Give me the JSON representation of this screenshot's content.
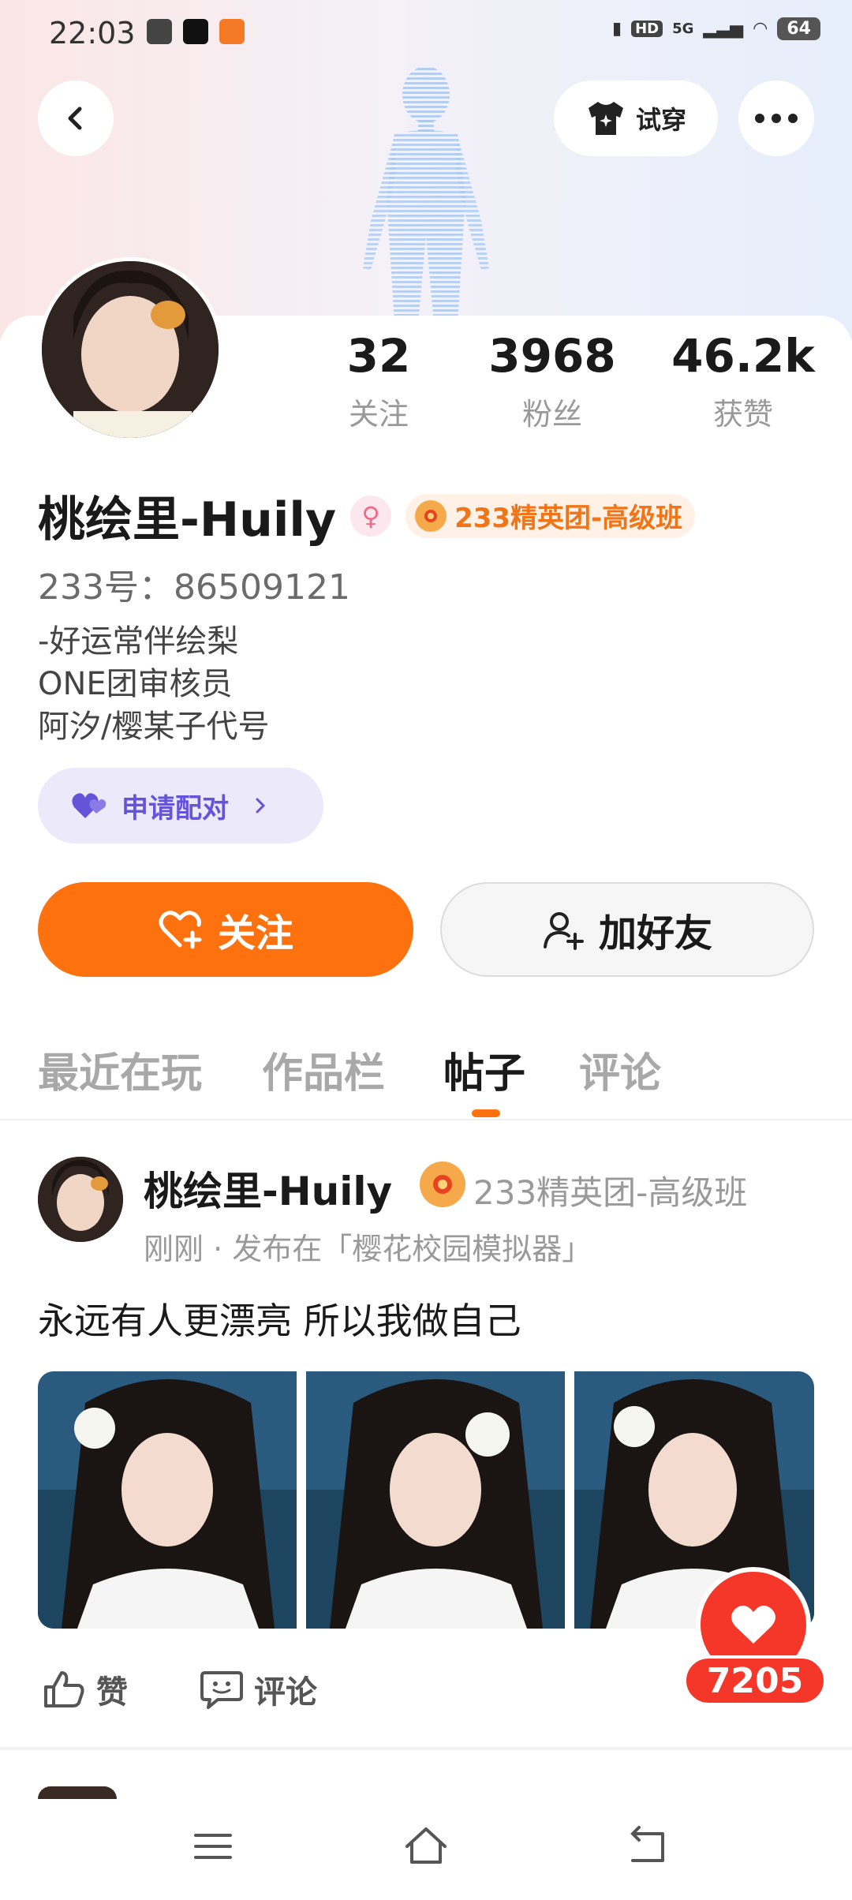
{
  "status_bar": {
    "time": "22:03",
    "network": "5G",
    "hd": "HD",
    "battery": "64"
  },
  "header": {
    "try_on_label": "试穿",
    "icons": [
      "back-icon",
      "tshirt-icon",
      "more-icon"
    ]
  },
  "profile": {
    "stats": [
      {
        "value": "32",
        "label": "关注"
      },
      {
        "value": "3968",
        "label": "粉丝"
      },
      {
        "value": "46.2k",
        "label": "获赞"
      }
    ],
    "name": "桃绘里-Huily",
    "gender_symbol": "♀",
    "elite_badge": "233精英团-高级班",
    "uid": "233号：86509121",
    "bio_lines": [
      "-好运常伴绘梨",
      "ONE团审核员",
      "阿汐/樱某子代号"
    ],
    "pair_label": "申请配对",
    "follow_label": "关注",
    "add_friend_label": "加好友"
  },
  "tabs": [
    {
      "label": "最近在玩",
      "active": false
    },
    {
      "label": "作品栏",
      "active": false
    },
    {
      "label": "帖子",
      "active": true
    },
    {
      "label": "评论",
      "active": false
    }
  ],
  "post": {
    "author": "桃绘里-Huily",
    "badge": "233精英团-高级班",
    "meta": "刚刚 · 发布在「樱花校园模拟器」",
    "text": "永远有人更漂亮 所以我做自己",
    "like_label": "赞",
    "comment_label": "评论",
    "heart_count": "7205"
  },
  "colors": {
    "accent": "#fd720f",
    "heart": "#f5372a",
    "pair": "#6553d8"
  }
}
